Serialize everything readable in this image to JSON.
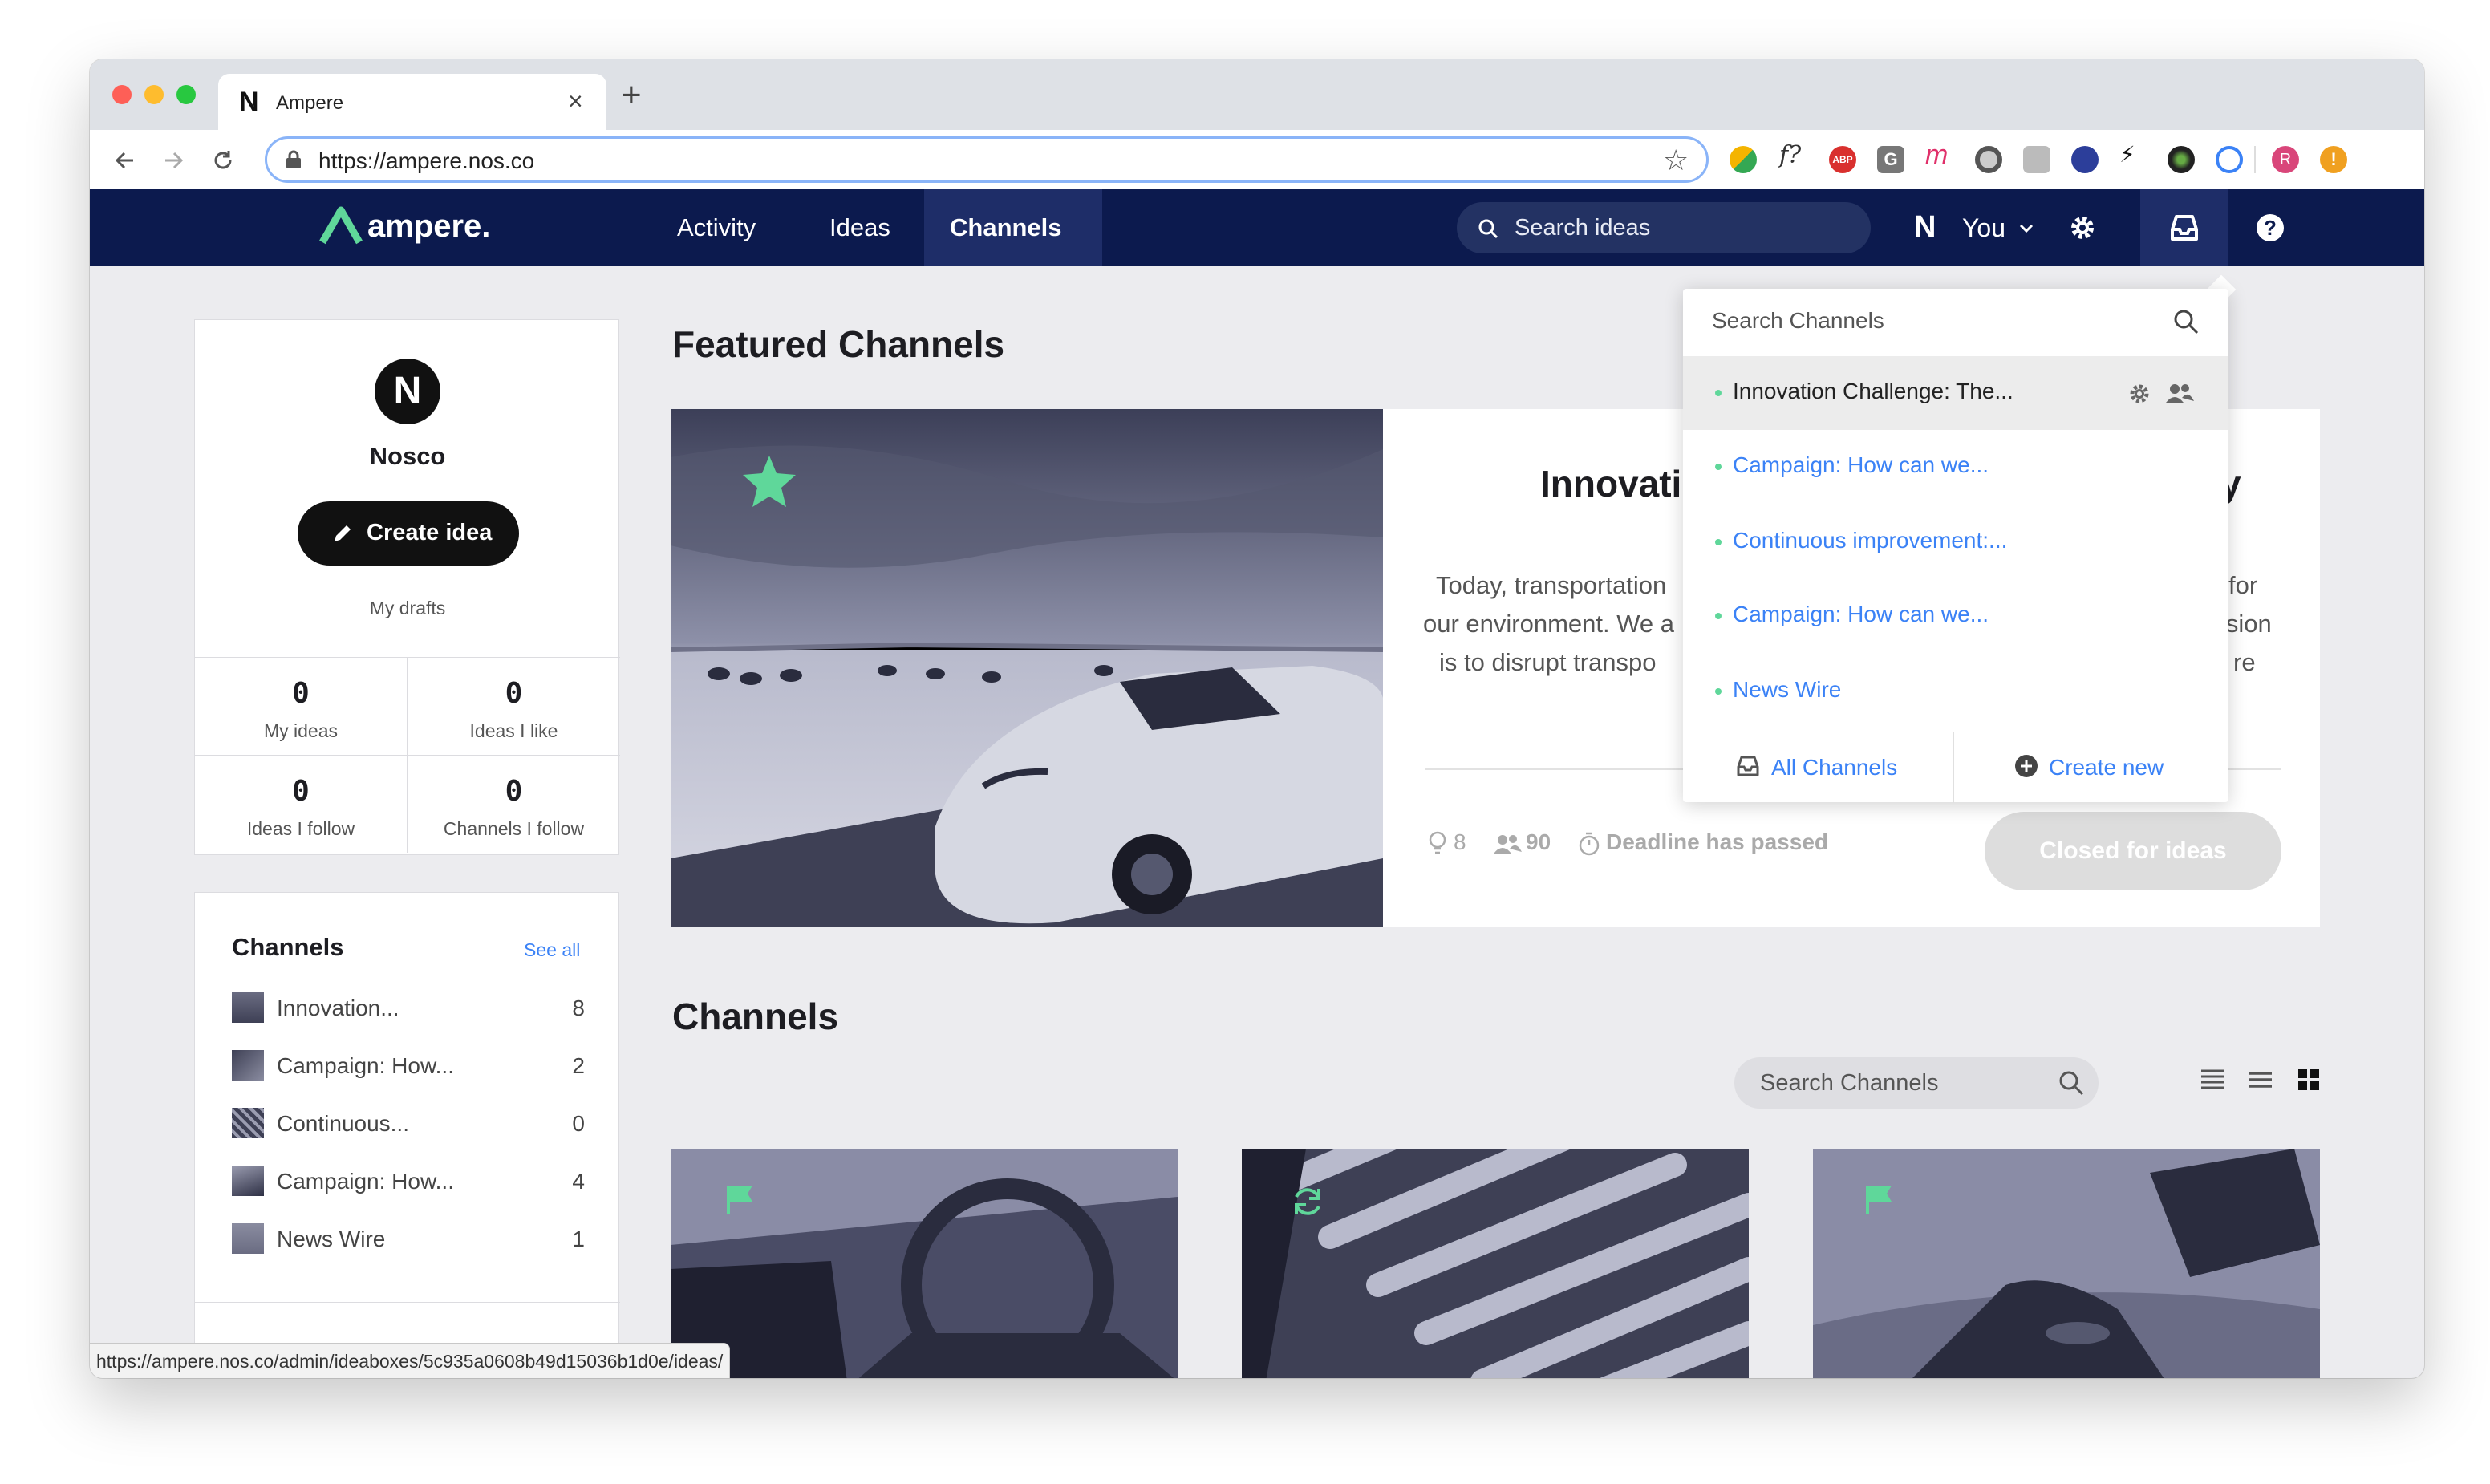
{
  "browser": {
    "tab_favicon": "N",
    "tab_title": "Ampere",
    "tab_close": "×",
    "new_tab": "+",
    "url": "https://ampere.nos.co",
    "status_url": "https://ampere.nos.co/admin/ideaboxes/5c935a0608b49d15036b1d0e/ideas/",
    "extension_icons": [
      "chat-extension-icon",
      "font-extension-icon",
      "adblock-extension-icon",
      "grammarly-extension-icon",
      "m-extension-icon",
      "circle-extension-icon",
      "screen-extension-icon",
      "stripe-extension-icon",
      "k-extension-icon",
      "dark-extension-icon",
      "vpn-extension-icon",
      "profile-avatar-icon",
      "alert-extension-icon"
    ],
    "profile_initial": "R"
  },
  "app": {
    "logo_text": "ampere.",
    "nav": {
      "activity": "Activity",
      "ideas": "Ideas",
      "channels": "Channels"
    },
    "search_placeholder": "Search ideas",
    "user_initial": "N",
    "user_label": "You",
    "accent": "#5fd79a",
    "nav_bg": "#0c1a4e"
  },
  "profile": {
    "avatar": "N",
    "name": "Nosco",
    "create_button": "Create idea",
    "drafts": "My drafts",
    "stats": [
      {
        "value": "0",
        "label": "My ideas"
      },
      {
        "value": "0",
        "label": "Ideas I like"
      },
      {
        "value": "0",
        "label": "Ideas I follow"
      },
      {
        "value": "0",
        "label": "Channels I follow"
      }
    ]
  },
  "sidebar_channels": {
    "title": "Channels",
    "see_all": "See all",
    "items": [
      {
        "name": "Innovation...",
        "count": "8"
      },
      {
        "name": "Campaign: How...",
        "count": "2"
      },
      {
        "name": "Continuous...",
        "count": "0"
      },
      {
        "name": "Campaign: How...",
        "count": "4"
      },
      {
        "name": "News Wire",
        "count": "1"
      }
    ]
  },
  "featured": {
    "section_title": "Featured Channels",
    "heading": "Innovation C",
    "heading_tail": "y",
    "text_left": [
      "Today, transportation",
      "our environment. We a",
      "is to disrupt transpo"
    ],
    "text_right": [
      "for",
      "ision",
      "re"
    ],
    "ideas_count": "8",
    "members_count": "90",
    "deadline": "Deadline has passed",
    "status_button": "Closed for ideas"
  },
  "channels_section": {
    "title": "Channels",
    "search_placeholder": "Search Channels"
  },
  "dropdown": {
    "search_placeholder": "Search Channels",
    "items": [
      {
        "label": "Innovation Challenge: The..."
      },
      {
        "label": "Campaign: How can we..."
      },
      {
        "label": "Continuous improvement:..."
      },
      {
        "label": "Campaign: How can we..."
      },
      {
        "label": "News Wire"
      }
    ],
    "all_channels": "All Channels",
    "create_new": "Create new"
  }
}
